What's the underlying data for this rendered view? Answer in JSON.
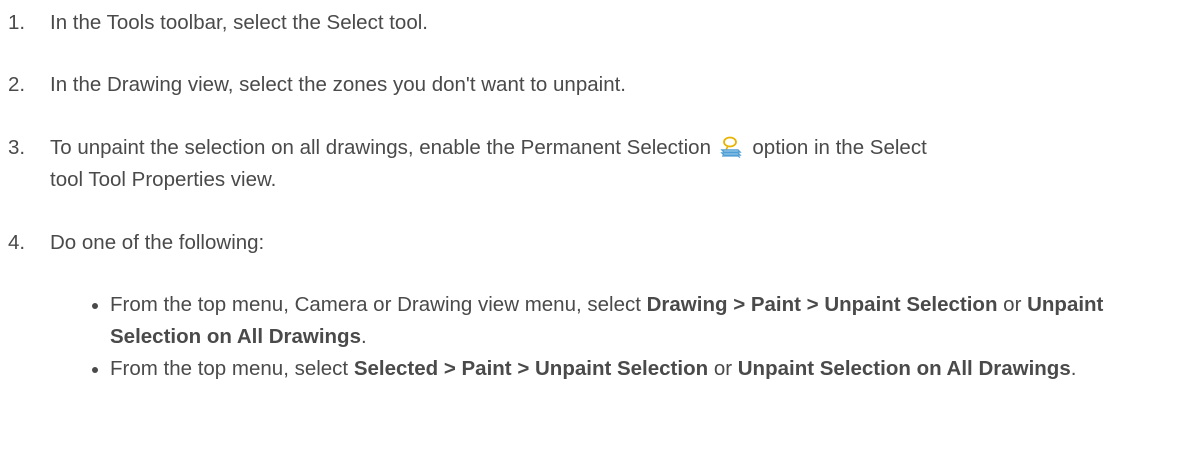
{
  "steps": [
    {
      "number": "1.",
      "text": "In the Tools toolbar, select the Select tool."
    },
    {
      "number": "2.",
      "text": "In the Drawing view, select the zones you don't want to unpaint."
    },
    {
      "number": "3.",
      "text_before_icon": "To unpaint the selection on all drawings, enable the Permanent Selection",
      "icon": "permanent-selection-icon",
      "text_after_icon_line1": "option in the Select",
      "text_line2": "tool Tool Properties view."
    },
    {
      "number": "4.",
      "text": "Do one of the following:"
    }
  ],
  "bullets": [
    {
      "prefix": "From the top menu, Camera or Drawing view menu, select ",
      "bold1": "Drawing > Paint > Unpaint Selection",
      "middle": " or ",
      "bold2": "Unpaint Selection on All Drawings",
      "suffix": "."
    },
    {
      "prefix": "From the top menu, select ",
      "bold1": "Selected > Paint > Unpaint Selection",
      "middle": " or ",
      "bold2": "Unpaint Selection on All Drawings",
      "suffix": "."
    }
  ],
  "colors": {
    "text": "#4a4a4a",
    "icon_accent": "#e8b400",
    "icon_secondary": "#4f9fd6"
  }
}
